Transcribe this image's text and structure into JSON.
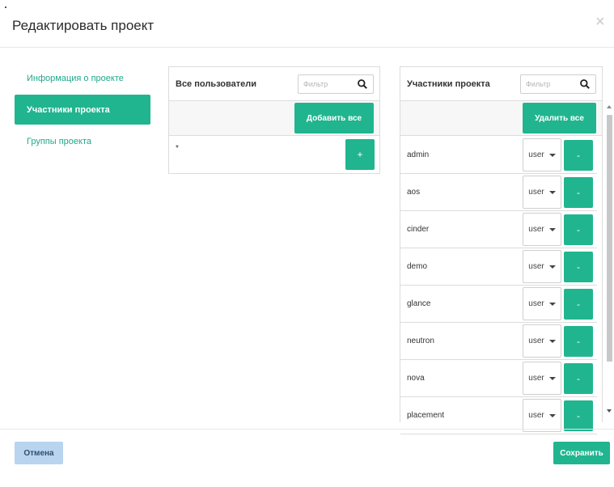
{
  "modal": {
    "title": "Редактировать проект",
    "close_glyph": "×"
  },
  "nav": {
    "items": [
      {
        "label": "Информация о проекте",
        "active": false
      },
      {
        "label": "Участники проекта",
        "active": true
      },
      {
        "label": "Группы проекта",
        "active": false
      }
    ]
  },
  "all_users": {
    "title": "Все пользователи",
    "filter_placeholder": "Фильтр",
    "add_all_label": "Добавить все",
    "rows": [
      {
        "name": "*",
        "action": "+"
      }
    ]
  },
  "members": {
    "title": "Участники проекта",
    "filter_placeholder": "Фильтр",
    "remove_all_label": "Удалить все",
    "rows": [
      {
        "name": "admin",
        "role": "user",
        "action": "-"
      },
      {
        "name": "aos",
        "role": "user",
        "action": "-"
      },
      {
        "name": "cinder",
        "role": "user",
        "action": "-"
      },
      {
        "name": "demo",
        "role": "user",
        "action": "-"
      },
      {
        "name": "glance",
        "role": "user",
        "action": "-"
      },
      {
        "name": "neutron",
        "role": "user",
        "action": "-"
      },
      {
        "name": "nova",
        "role": "user",
        "action": "-"
      },
      {
        "name": "placement",
        "role": "user",
        "action": "-"
      }
    ]
  },
  "footer": {
    "cancel_label": "Отмена",
    "save_label": "Сохранить"
  },
  "colors": {
    "accent": "#20b58f",
    "nav_link": "#1fa98a",
    "cancel_bg": "#b8d4ee"
  },
  "icons": {
    "search": "search-icon",
    "close": "close-icon",
    "caret": "caret-down-icon"
  }
}
